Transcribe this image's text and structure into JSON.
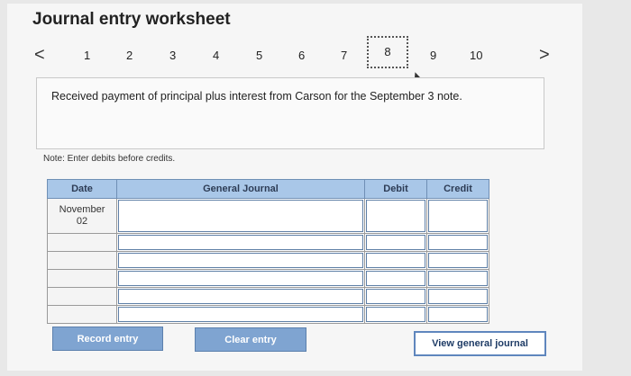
{
  "title": "Journal entry worksheet",
  "nav": {
    "prev": "<",
    "next": ">",
    "pages": [
      "1",
      "2",
      "3",
      "4",
      "5",
      "6",
      "7",
      "8",
      "9",
      "10"
    ],
    "active_index": 7
  },
  "description": "Received payment of principal plus interest from Carson for the September 3 note.",
  "note": "Note: Enter debits before credits.",
  "table": {
    "headers": {
      "date": "Date",
      "account": "General Journal",
      "debit": "Debit",
      "credit": "Credit"
    },
    "date_value": "November\n02",
    "rows": 6
  },
  "buttons": {
    "record": "Record entry",
    "clear": "Clear entry",
    "view": "View general journal"
  }
}
